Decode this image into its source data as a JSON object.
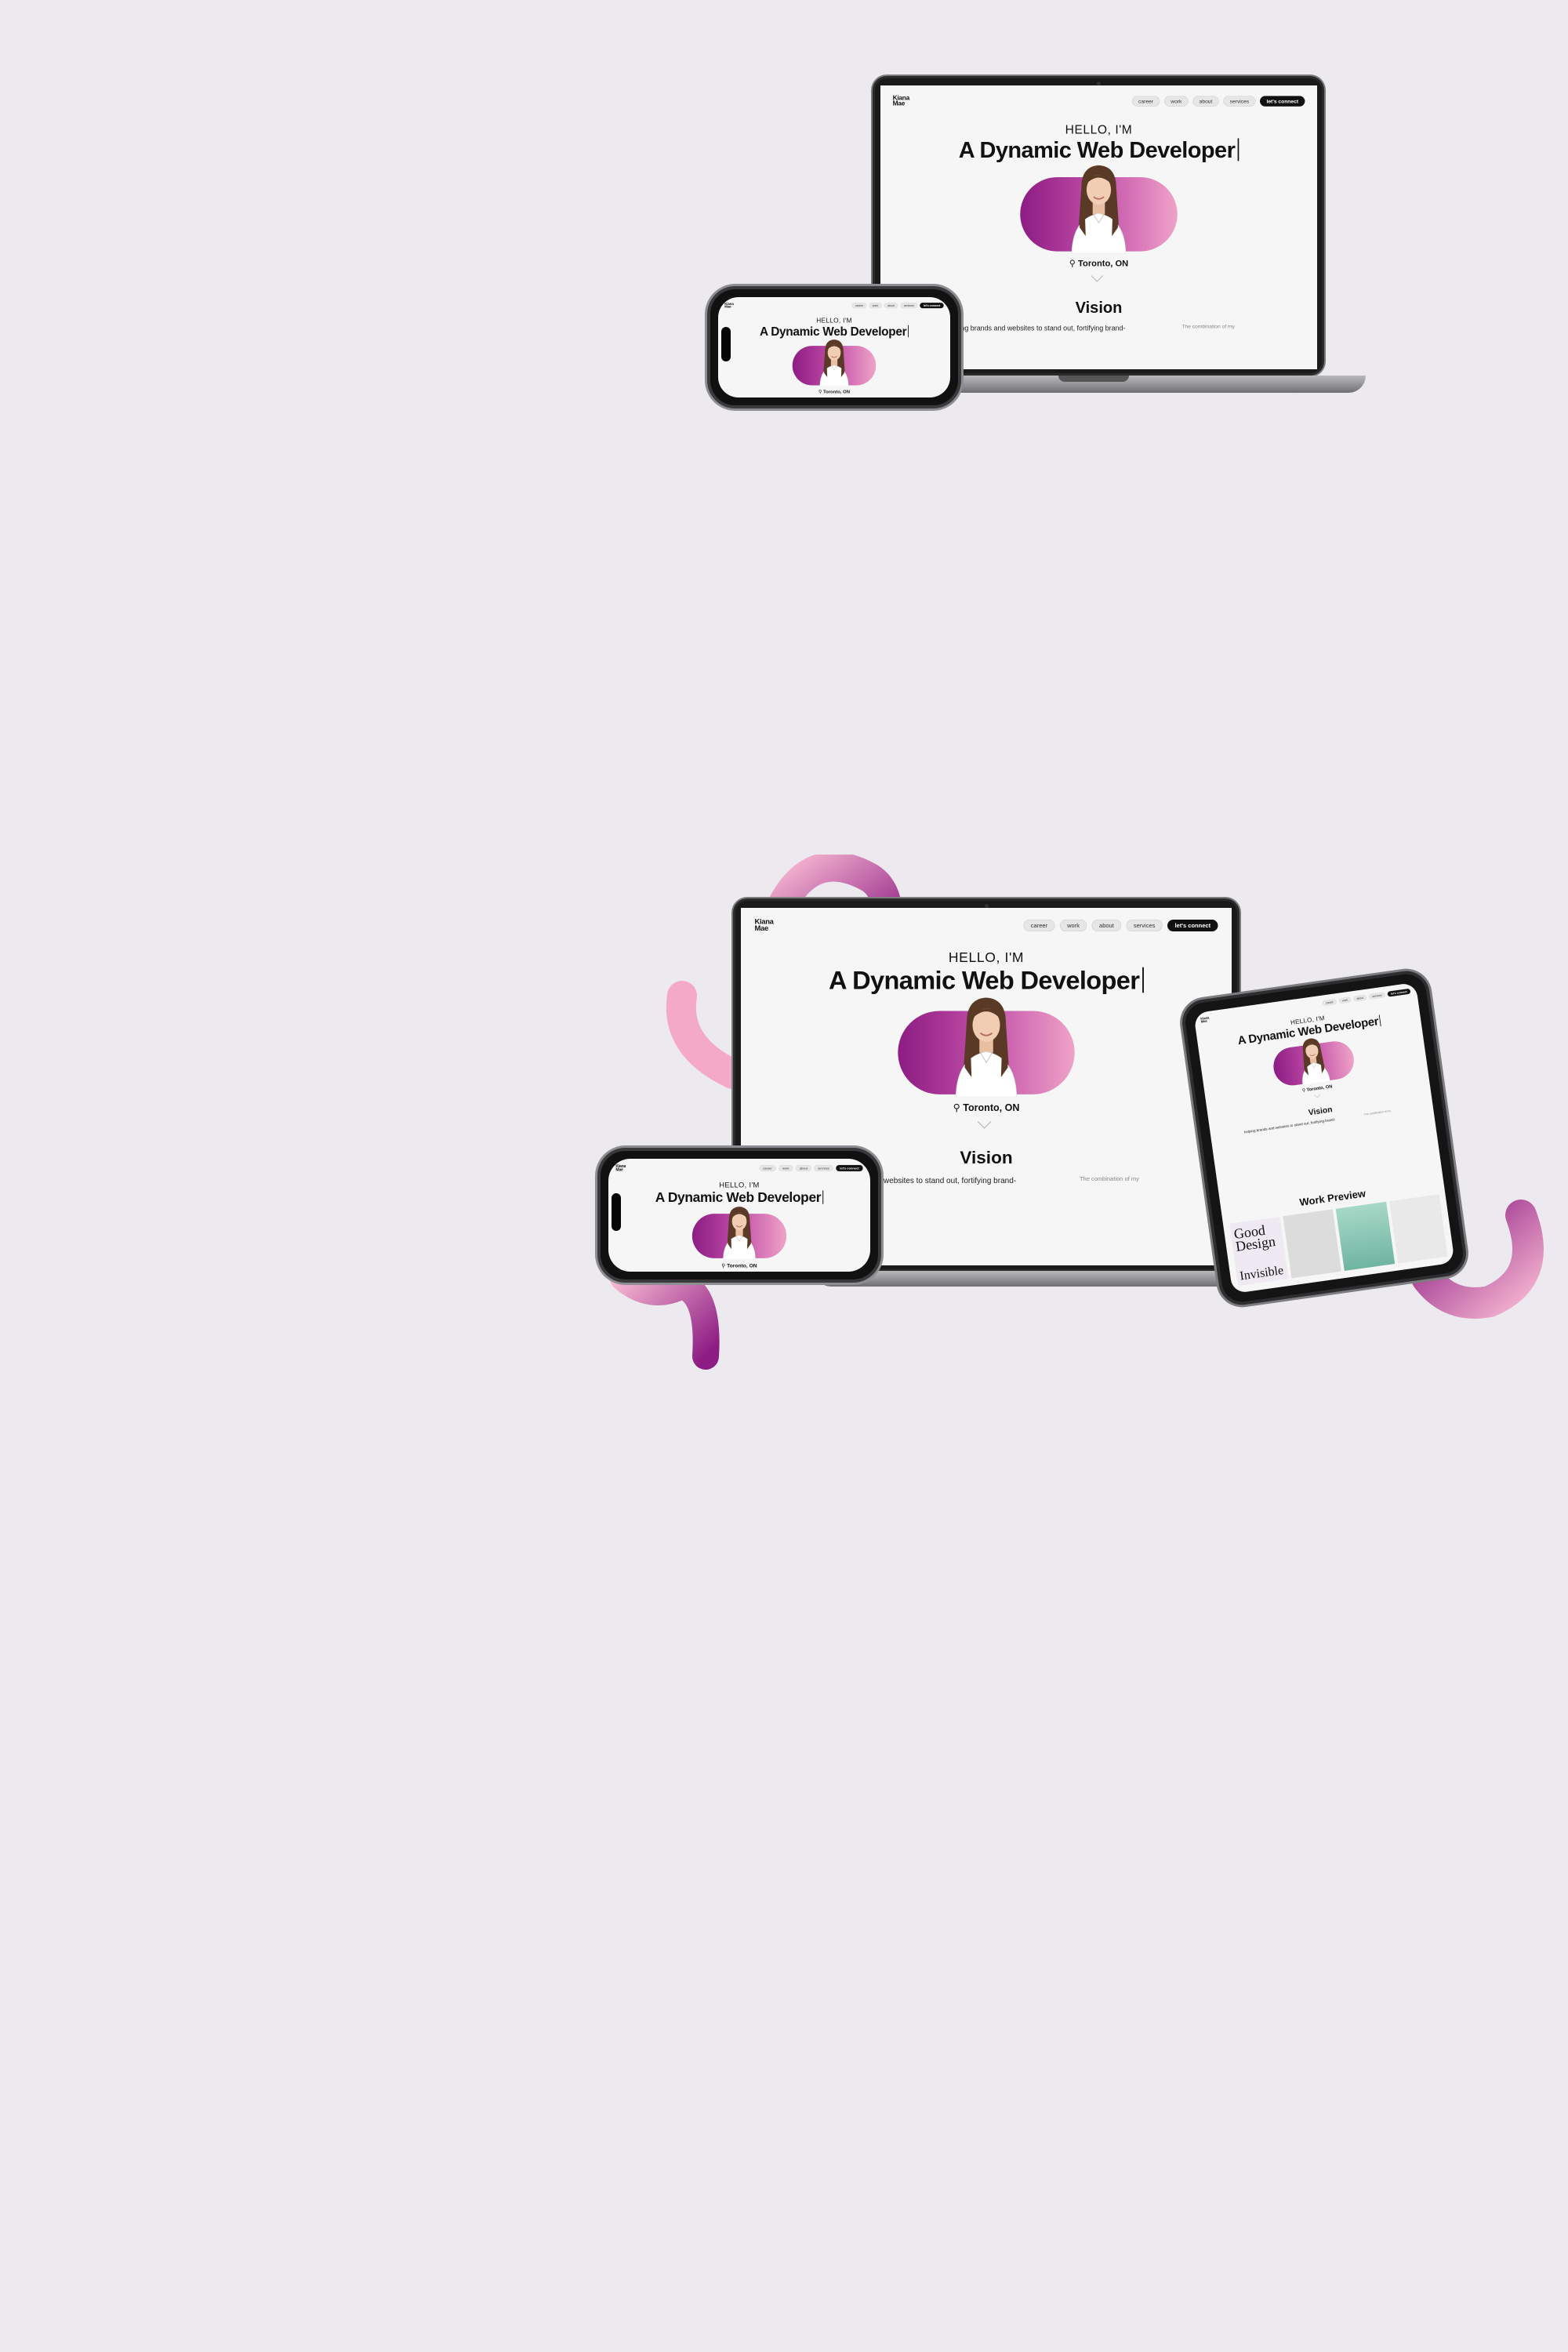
{
  "site": {
    "logo_line1": "Kiana",
    "logo_line2": "Mae",
    "nav": [
      "career",
      "work",
      "about",
      "services"
    ],
    "cta": "let's connect",
    "greeting": "HELLO, I'M",
    "headline": "A Dynamic Web Developer",
    "location": "Toronto, ON",
    "section_title": "Vision",
    "vision_text": "helping brands and websites to stand out, fortifying brand-",
    "vision_side_text": "The combination of my",
    "work_preview_title": "Work Preview",
    "preview_card_1": "Good Design",
    "preview_card_2": "Invisible"
  },
  "colors": {
    "background": "#ECEAEE",
    "screen": "#F6F6F6",
    "accent_dark": "#8D1C84",
    "accent_mid": "#C24FA8",
    "accent_light": "#EFA3C8",
    "text": "#111111"
  },
  "icons": {
    "location": "map-pin-icon",
    "scroll": "chevron-down-icon"
  }
}
